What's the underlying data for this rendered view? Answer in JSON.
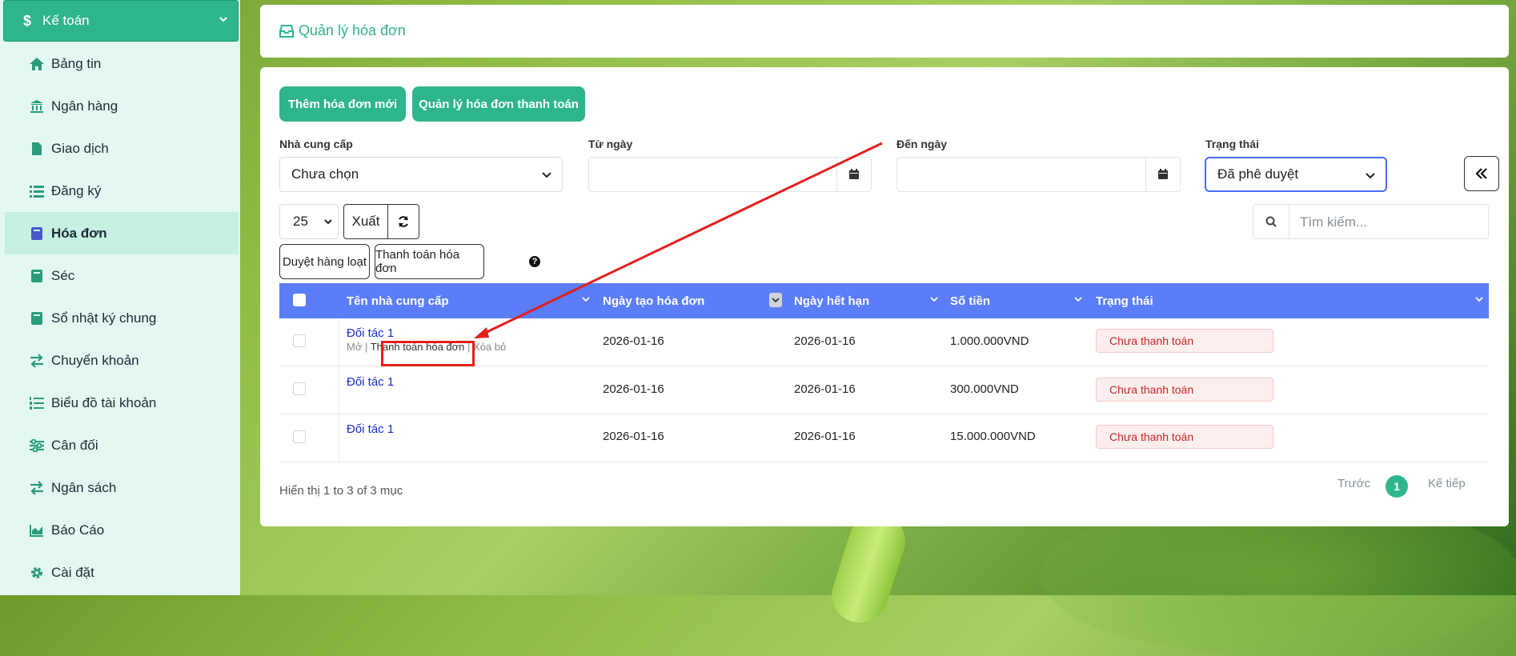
{
  "sidebar": {
    "section_title": "Kế toán",
    "items": [
      {
        "label": "Bảng tin",
        "icon": "home-icon"
      },
      {
        "label": "Ngân hàng",
        "icon": "bank-icon"
      },
      {
        "label": "Giao dịch",
        "icon": "file-icon"
      },
      {
        "label": "Đăng ký",
        "icon": "list-icon"
      },
      {
        "label": "Hóa đơn",
        "icon": "book-icon",
        "active": true
      },
      {
        "label": "Séc",
        "icon": "book-icon"
      },
      {
        "label": "Sổ nhật ký chung",
        "icon": "book-icon"
      },
      {
        "label": "Chuyển khoản",
        "icon": "exchange-icon"
      },
      {
        "label": "Biểu đồ tài khoản",
        "icon": "list-ol-icon"
      },
      {
        "label": "Cân đối",
        "icon": "sliders-icon"
      },
      {
        "label": "Ngân sách",
        "icon": "exchange-icon"
      },
      {
        "label": "Báo Cáo",
        "icon": "area-chart-icon"
      },
      {
        "label": "Cài đặt",
        "icon": "gear-icon"
      }
    ]
  },
  "header": {
    "title": "Quản lý hóa đơn"
  },
  "toolbar": {
    "new_invoice": "Thêm hóa đơn mới",
    "manage_payments": "Quản lý hóa đơn thanh toán"
  },
  "filters": {
    "supplier_label": "Nhà cung cấp",
    "supplier_value": "Chưa chọn",
    "from_label": "Từ ngày",
    "to_label": "Đến ngày",
    "status_label": "Trạng thái",
    "status_value": "Đã phê duyệt"
  },
  "controls": {
    "page_length": "25",
    "export": "Xuất",
    "search_placeholder": "Tìm kiếm...",
    "bulk_approve": "Duyệt hàng loạt",
    "pay_invoice": "Thanh toán hóa đơn",
    "help": "?"
  },
  "table": {
    "columns": [
      "Tên nhà cung cấp",
      "Ngày tạo hóa đơn",
      "Ngày hết hạn",
      "Số tiền",
      "Trạng thái"
    ],
    "row_actions": {
      "open": "Mở",
      "pay": "Thanh toán hóa đơn",
      "delete": "Xóa bỏ"
    },
    "rows": [
      {
        "partner": "Đối tác 1",
        "created": "2026-01-16",
        "due": "2026-01-16",
        "amount": "1.000.000VND",
        "status": "Chưa thanh toán"
      },
      {
        "partner": "Đối tác 1",
        "created": "2026-01-16",
        "due": "2026-01-16",
        "amount": "300.000VND",
        "status": "Chưa thanh toán"
      },
      {
        "partner": "Đối tác 1",
        "created": "2026-01-16",
        "due": "2026-01-16",
        "amount": "15.000.000VND",
        "status": "Chưa thanh toán"
      }
    ]
  },
  "footer": {
    "info": "Hiển thị 1 to 3 of 3 mục",
    "prev": "Trước",
    "page": "1",
    "next": "Kế tiếp"
  },
  "colors": {
    "accent": "#2fb58e",
    "table_header": "#5b7ef8",
    "annotation": "#e41e1e"
  }
}
